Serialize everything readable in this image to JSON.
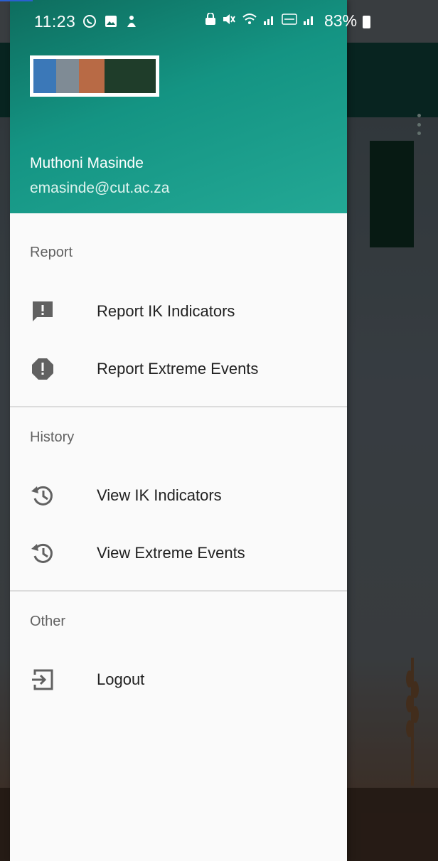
{
  "status_bar": {
    "time": "11:23",
    "battery": "83%",
    "left_icons": [
      "whatsapp-icon",
      "gallery-icon",
      "app-notification-icon"
    ],
    "right_icons": [
      "lock-icon",
      "mute-icon",
      "wifi-icon",
      "signal-icon",
      "volte-icon",
      "signal-icon-2"
    ]
  },
  "drawer": {
    "user": {
      "name": "Muthoni Masinde",
      "email": "emasinde@cut.ac.za"
    },
    "sections": [
      {
        "title": "Report",
        "items": [
          {
            "label": "Report IK Indicators",
            "icon": "report-feedback-icon"
          },
          {
            "label": "Report Extreme Events",
            "icon": "alert-octagon-icon"
          }
        ]
      },
      {
        "title": "History",
        "items": [
          {
            "label": "View IK Indicators",
            "icon": "history-icon"
          },
          {
            "label": "View Extreme Events",
            "icon": "history-icon"
          }
        ]
      },
      {
        "title": "Other",
        "items": [
          {
            "label": "Logout",
            "icon": "logout-icon"
          }
        ]
      }
    ]
  },
  "colors": {
    "header_gradient_start": "#0e6d5e",
    "header_gradient_end": "#23a895",
    "drawer_background": "#fafafa",
    "text_primary": "#212121",
    "text_secondary": "#616161"
  }
}
